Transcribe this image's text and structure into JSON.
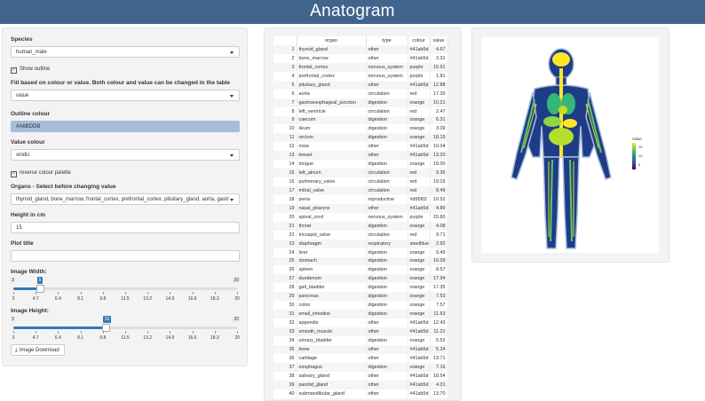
{
  "header": {
    "title": "Anatogram"
  },
  "sidebar": {
    "species_label": "Species",
    "species_value": "human_male",
    "show_outline_label": "Show outline",
    "show_outline_checked": true,
    "fill_label": "Fill based on colour or value. Both colour and value can be changed in the table",
    "fill_value": "value",
    "outline_colour_label": "Outline colour",
    "outline_colour_value": "#A6BDDB",
    "value_colour_label": "Value colour",
    "value_colour_value": "viridis",
    "reverse_palette_label": "reverse colour palette",
    "reverse_palette_checked": true,
    "organs_label": "Organs - Select before changing value",
    "organs_value": "thyroid_gland, bone_marrow, frontal_cortex, prefrontal_cortex, pituitary_gland, aorta, gastr",
    "height_label": "Height in cm",
    "height_value": "15",
    "plot_title_label": "Plot title",
    "plot_title_value": "",
    "width_slider": {
      "label": "Image Width:",
      "min": 3,
      "max": 20,
      "value": 5,
      "tick_labels": [
        "3",
        "4.7",
        "6.4",
        "8.1",
        "9.8",
        "11.5",
        "13.2",
        "14.9",
        "16.6",
        "18.3",
        "20"
      ]
    },
    "height_slider": {
      "label": "Image Height:",
      "min": 3,
      "max": 20,
      "value": 10,
      "tick_labels": [
        "3",
        "4.7",
        "6.4",
        "8.1",
        "9.8",
        "11.5",
        "13.2",
        "14.9",
        "16.6",
        "18.3",
        "20"
      ]
    },
    "download_label": "Image Download"
  },
  "table": {
    "columns": [
      "",
      "organ",
      "type",
      "colour",
      "value"
    ],
    "rows": [
      [
        "1",
        "thyroid_gland",
        "other",
        "#41ab5d",
        "4.67"
      ],
      [
        "2",
        "bone_marrow",
        "other",
        "#41ab5d",
        "3.31"
      ],
      [
        "3",
        "frontal_cortex",
        "nervous_system",
        "purple",
        "15.51"
      ],
      [
        "4",
        "prefrontal_cortex",
        "nervous_system",
        "purple",
        "1.81"
      ],
      [
        "5",
        "pituitary_gland",
        "other",
        "#41ab5d",
        "12.88"
      ],
      [
        "6",
        "aorta",
        "circulation",
        "red",
        "17.30"
      ],
      [
        "7",
        "gastroesophageal_junction",
        "digestion",
        "orange",
        "10.21"
      ],
      [
        "8",
        "left_ventricle",
        "circulation",
        "red",
        "2.47"
      ],
      [
        "9",
        "caecum",
        "digestion",
        "orange",
        "6.31"
      ],
      [
        "10",
        "ileum",
        "digestion",
        "orange",
        "3.09"
      ],
      [
        "11",
        "rectum",
        "digestion",
        "orange",
        "18.15"
      ],
      [
        "12",
        "nose",
        "other",
        "#41ab5d",
        "10.04"
      ],
      [
        "13",
        "breast",
        "other",
        "#41ab5d",
        "13.20"
      ],
      [
        "14",
        "tongue",
        "digestion",
        "orange",
        "19.00"
      ],
      [
        "15",
        "left_atrium",
        "circulation",
        "red",
        "9.35"
      ],
      [
        "16",
        "pulmonary_valve",
        "circulation",
        "red",
        "19.03"
      ],
      [
        "17",
        "mitral_valve",
        "circulation",
        "red",
        "8.49"
      ],
      [
        "18",
        "penis",
        "reproductive",
        "#d95f02",
        "10.52"
      ],
      [
        "19",
        "nasal_pharynx",
        "other",
        "#41ab5d",
        "4.89"
      ],
      [
        "20",
        "spinal_cord",
        "nervous_system",
        "purple",
        "15.80"
      ],
      [
        "21",
        "throat",
        "digestion",
        "orange",
        "4.08"
      ],
      [
        "22",
        "tricuspid_valve",
        "circulation",
        "red",
        "9.71"
      ],
      [
        "23",
        "diaphragm",
        "respiratory",
        "steelblue",
        "2.92"
      ],
      [
        "24",
        "liver",
        "digestion",
        "orange",
        "9.49"
      ],
      [
        "25",
        "stomach",
        "digestion",
        "orange",
        "16.09"
      ],
      [
        "26",
        "spleen",
        "digestion",
        "orange",
        "8.57"
      ],
      [
        "27",
        "duodenum",
        "digestion",
        "orange",
        "17.94"
      ],
      [
        "28",
        "gall_bladder",
        "digestion",
        "orange",
        "17.35"
      ],
      [
        "29",
        "pancreas",
        "digestion",
        "orange",
        "7.53"
      ],
      [
        "30",
        "colon",
        "digestion",
        "orange",
        "7.57"
      ],
      [
        "31",
        "small_intestine",
        "digestion",
        "orange",
        "11.63"
      ],
      [
        "32",
        "appendix",
        "other",
        "#41ab5d",
        "12.43"
      ],
      [
        "33",
        "smooth_muscle",
        "other",
        "#41ab5d",
        "11.21"
      ],
      [
        "34",
        "urinary_bladder",
        "digestion",
        "orange",
        "5.52"
      ],
      [
        "35",
        "bone",
        "other",
        "#41ab5d",
        "5.24"
      ],
      [
        "36",
        "cartilage",
        "other",
        "#41ab5d",
        "13.71"
      ],
      [
        "37",
        "esophagus",
        "digestion",
        "orange",
        "7.16"
      ],
      [
        "38",
        "salivary_gland",
        "other",
        "#41ab5d",
        "18.54"
      ],
      [
        "39",
        "parotid_gland",
        "other",
        "#41ab5d",
        "4.01"
      ],
      [
        "40",
        "submandibular_gland",
        "other",
        "#41ab5d",
        "13.70"
      ]
    ]
  },
  "plot": {
    "legend_title": "value",
    "legend_ticks": [
      "15",
      "10",
      "5"
    ]
  },
  "colors": {
    "header_bg": "#41648c",
    "accent": "#337ab7",
    "outline": "#A6BDDB"
  }
}
